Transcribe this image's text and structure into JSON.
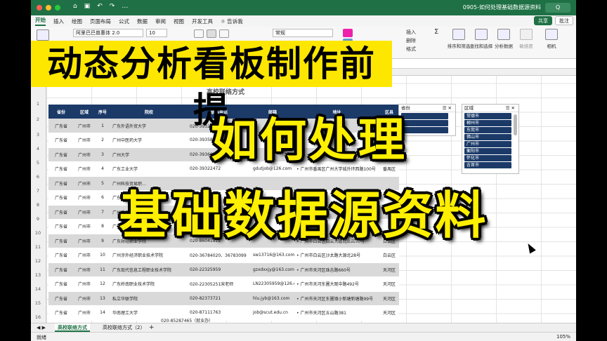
{
  "window": {
    "title": "0905-如何处理基础数据源资料",
    "search_label": "Q"
  },
  "ribbon_tabs": [
    "开始",
    "插入",
    "绘图",
    "页面布局",
    "公式",
    "数据",
    "审阅",
    "视图",
    "开发工具",
    "告诉我"
  ],
  "share": {
    "share_label": "共享",
    "comment_label": "批注"
  },
  "ribbon": {
    "paste_label": "粘贴",
    "font_name": "阿里巴巴普惠体 2.0",
    "font_size": "10",
    "number_format": "常规",
    "insert_label": "插入",
    "delete_label": "删除",
    "format_label": "格式",
    "sort_filter_label": "排序和筛选",
    "find_select_label": "查找和选择",
    "analyze_label": "分析数据",
    "sensitivity_label": "敏感度",
    "camera_label": "相机"
  },
  "sheet": {
    "title": "高校联络方式",
    "headers": [
      "省份",
      "区域",
      "序号",
      "院校",
      "联系电话",
      "邮箱",
      "地址",
      "区县"
    ],
    "rows": [
      [
        "广东省",
        "广州市",
        "1",
        "广东外语外贸大学",
        "020-39328003、020-3932…",
        "",
        "",
        ""
      ],
      [
        "广东省",
        "广州市",
        "2",
        "广州中医药大学",
        "020-39358457",
        "",
        "",
        ""
      ],
      [
        "广东省",
        "广州市",
        "3",
        "广州大学",
        "020-39366235",
        "",
        "",
        ""
      ],
      [
        "广东省",
        "广州市",
        "4",
        "广东工业大学",
        "020-39322472",
        "gdutjob@126.com",
        "• 广州市番禺区广州大学城外环西路100号",
        "番禺区"
      ],
      [
        "广东省",
        "广州市",
        "5",
        "广州科技贸易职…",
        "",
        "",
        "",
        ""
      ],
      [
        "广东省",
        "广州市",
        "6",
        "广东医科大学",
        "",
        "",
        "",
        ""
      ],
      [
        "广东省",
        "广州市",
        "7",
        "广州番禺职业…",
        "",
        "",
        "",
        ""
      ],
      [
        "广东省",
        "广州市",
        "8",
        "广州民航职业技…",
        "",
        "",
        "",
        ""
      ],
      [
        "广东省",
        "广州市",
        "9",
        "广东财经职业学院",
        "020-86041822",
        "",
        "• 广州市白云区白云大道北么吕50号",
        "白云区"
      ],
      [
        "广东省",
        "广州市",
        "10",
        "广州涉外经济职业技术学院",
        "020-36784020、36783099",
        "sw13716@163.com",
        "• 广州市白云区沙太路大源北28号",
        "白云区"
      ],
      [
        "广东省",
        "广州市",
        "11",
        "广东现代信息工程职业技术学院",
        "020-22325959",
        "gzxdxxjy@163.com",
        "• 广州市天河区珠吉路660号",
        "天河区"
      ],
      [
        "广东省",
        "广州市",
        "12",
        "广东岭南职业技术学院",
        "020-22305251宋老师",
        "LN22305959@126.com",
        "• 广州市天河东圃大观中路492号",
        "天河区"
      ],
      [
        "广东省",
        "广州市",
        "13",
        "私立华联学院",
        "020-82373721",
        "hlu.jyb@163.com",
        "• 广州市天河区东圃镇小新塘新塘路99号",
        "天河区"
      ],
      [
        "广东省",
        "广州市",
        "14",
        "华南理工大学",
        "020-87111763",
        "job@scut.edu.cn",
        "• 广州市天河区五山路381",
        "天河区"
      ]
    ],
    "partial_row_phone": "020-85287465（就业办）"
  },
  "slicer_province": {
    "title": "省份",
    "items": [
      "",
      "",
      ""
    ]
  },
  "slicer_region": {
    "title": "区域",
    "items": [
      "常德市",
      "郴州市",
      "东莞市",
      "佛山市",
      "广州市",
      "衡阳市",
      "怀化市",
      "吉首市"
    ]
  },
  "sheet_tabs": [
    "高校联络方式",
    "高校联络方式（2）"
  ],
  "status": {
    "ready": "就绪",
    "zoom": "105%"
  },
  "overlay": {
    "banner": "动态分析看板制作前提",
    "line1": "如何处理",
    "line2": "基础数据源资料"
  },
  "colors": {
    "accent": "#1f7145",
    "table_header": "#1b3a68",
    "banner": "#fde700",
    "overlay_text": "#ffef00"
  }
}
